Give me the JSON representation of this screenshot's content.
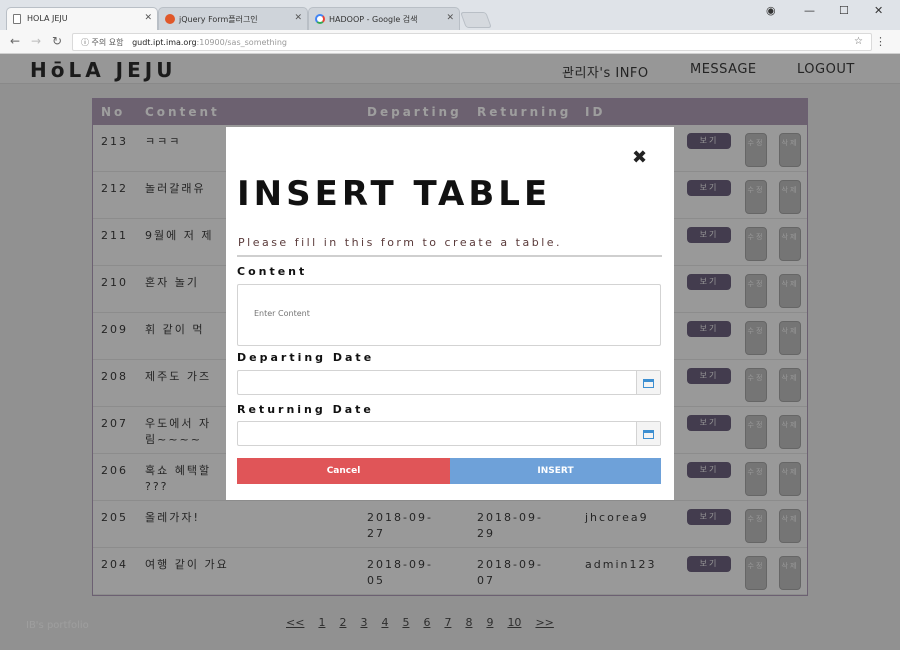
{
  "browser": {
    "tabs": [
      {
        "title": "HOLA JEJU",
        "favicon": "page-icon",
        "active": true
      },
      {
        "title": "jQuery Form플러그인",
        "favicon": "orange-circle-icon",
        "active": false
      },
      {
        "title": "HADOOP - Google 검색",
        "favicon": "google-icon",
        "active": false
      }
    ],
    "address": {
      "security": "ⓘ 주의 요함",
      "host": "gudt.ipt.ima.org",
      "path": ":10900/sas_something"
    }
  },
  "header": {
    "logo": "HōLA JEJU",
    "nav": [
      "관리자's INFO",
      "MESSAGE",
      "LOGOUT"
    ]
  },
  "table": {
    "columns": [
      "No",
      "Content",
      "Departing",
      "Returning",
      "ID"
    ],
    "rows": [
      {
        "no": "213",
        "content": "ㅋㅋㅋ",
        "departing": "",
        "returning": "",
        "id": ""
      },
      {
        "no": "212",
        "content": "놀러갈래유",
        "departing": "",
        "returning": "",
        "id": ""
      },
      {
        "no": "211",
        "content": "9월에 저 제",
        "departing": "",
        "returning": "",
        "id": ""
      },
      {
        "no": "210",
        "content": "혼자 놀기",
        "departing": "",
        "returning": "",
        "id": ""
      },
      {
        "no": "209",
        "content": "휘 같이 먹",
        "departing": "",
        "returning": "",
        "id": ""
      },
      {
        "no": "208",
        "content": "제주도 가즈",
        "departing": "",
        "returning": "",
        "id": ""
      },
      {
        "no": "207",
        "content": "우도에서 자\n림~~~~",
        "departing": "",
        "returning": "",
        "id": ""
      },
      {
        "no": "206",
        "content": "혹쇼 혜택할\n???",
        "departing": "",
        "returning": "",
        "id": ""
      },
      {
        "no": "205",
        "content": "올레가자!",
        "departing": "2018-09-\n27",
        "returning": "2018-09-\n29",
        "id": "jhcorea9"
      },
      {
        "no": "204",
        "content": "여행 같이 가요",
        "departing": "2018-09-\n05",
        "returning": "2018-09-\n07",
        "id": "admin123"
      }
    ],
    "view_label": "보기",
    "edit_label": "수정",
    "delete_label": "삭제"
  },
  "footer": {
    "credit": "IB's portfolio",
    "pager": [
      "<<",
      "1",
      "2",
      "3",
      "4",
      "5",
      "6",
      "7",
      "8",
      "9",
      "10",
      ">>"
    ]
  },
  "modal": {
    "title": "INSERT TABLE",
    "subtitle": "Please fill in this form to create a table.",
    "content_label": "Content",
    "content_placeholder": "Enter Content",
    "departing_label": "Departing Date",
    "returning_label": "Returning Date",
    "cancel_label": "Cancel",
    "insert_label": "INSERT"
  },
  "colors": {
    "table_header": "#a591ab",
    "view_button": "#5a4e6e",
    "cancel": "#e05558",
    "insert": "#6ea1d9"
  }
}
